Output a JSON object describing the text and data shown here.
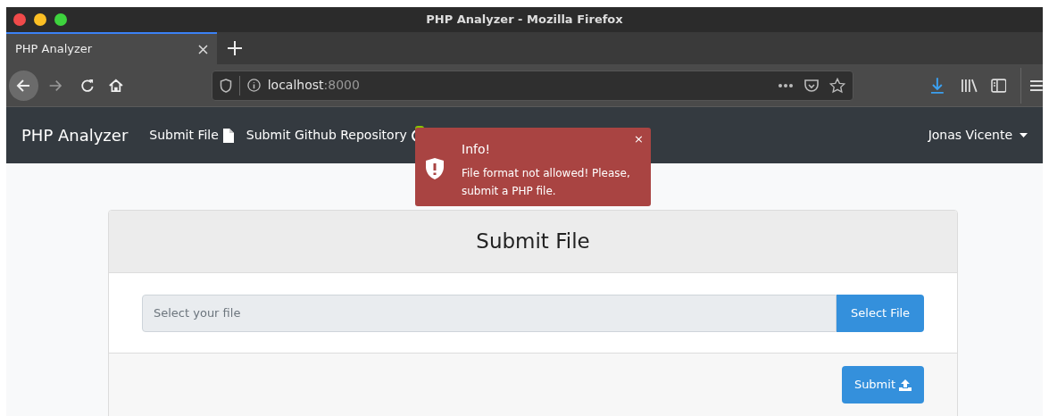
{
  "window": {
    "title": "PHP Analyzer - Mozilla Firefox"
  },
  "tabs": [
    {
      "label": "PHP Analyzer",
      "selected": true
    }
  ],
  "address_bar": {
    "host": "localhost",
    "port": ":8000"
  },
  "navbar": {
    "brand": "PHP Analyzer",
    "links": [
      {
        "label": "Submit File",
        "kind": "file"
      },
      {
        "label": "Submit Github Repository",
        "kind": "github"
      }
    ],
    "user": "Jonas Vicente"
  },
  "toast": {
    "title": "Info!",
    "message": "File format not allowed! Please, submit a PHP file.",
    "close": "×"
  },
  "card": {
    "title": "Submit File",
    "file_field": {
      "placeholder": "Select your file"
    },
    "select_button": "Select File",
    "submit_button": "Submit"
  }
}
